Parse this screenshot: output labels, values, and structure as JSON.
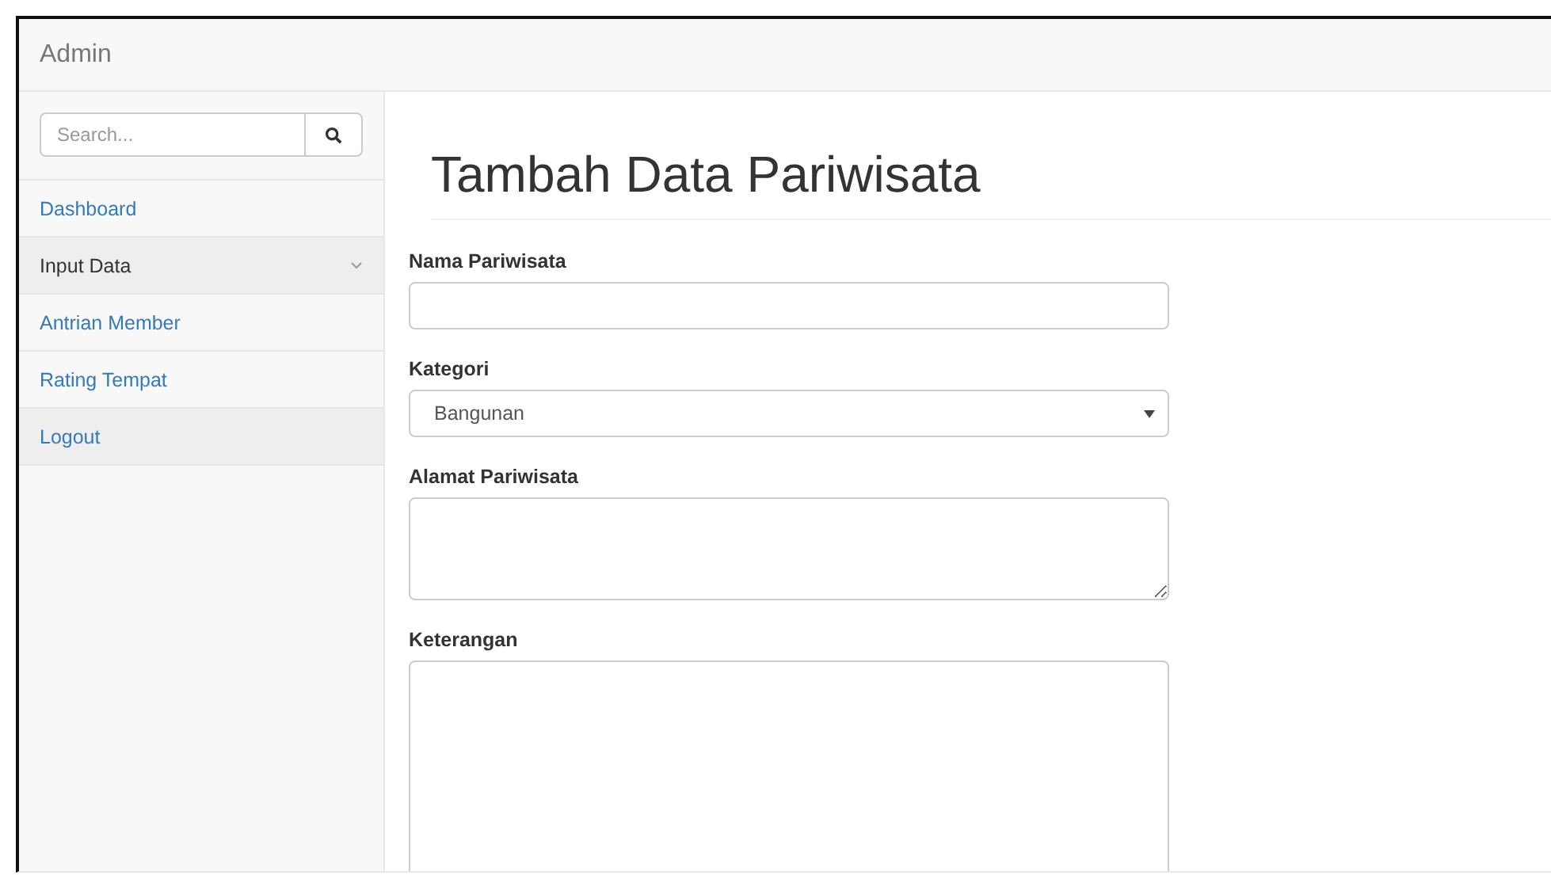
{
  "navbar": {
    "brand": "Admin"
  },
  "sidebar": {
    "search": {
      "placeholder": "Search..."
    },
    "items": [
      {
        "label": "Dashboard",
        "highlighted": false,
        "has_dropdown": false
      },
      {
        "label": "Input Data",
        "highlighted": true,
        "has_dropdown": true
      },
      {
        "label": "Antrian Member",
        "highlighted": false,
        "has_dropdown": false
      },
      {
        "label": "Rating Tempat",
        "highlighted": false,
        "has_dropdown": false
      },
      {
        "label": "Logout",
        "highlighted": true,
        "has_dropdown": false
      }
    ]
  },
  "page": {
    "title": "Tambah Data Pariwisata",
    "fields": [
      {
        "kind": "text",
        "label": "Nama Pariwisata"
      },
      {
        "kind": "select",
        "label": "Kategori",
        "value": "Bangunan"
      },
      {
        "kind": "textarea",
        "label": "Alamat Pariwisata"
      },
      {
        "kind": "textarea-tall",
        "label": "Keterangan"
      }
    ]
  }
}
